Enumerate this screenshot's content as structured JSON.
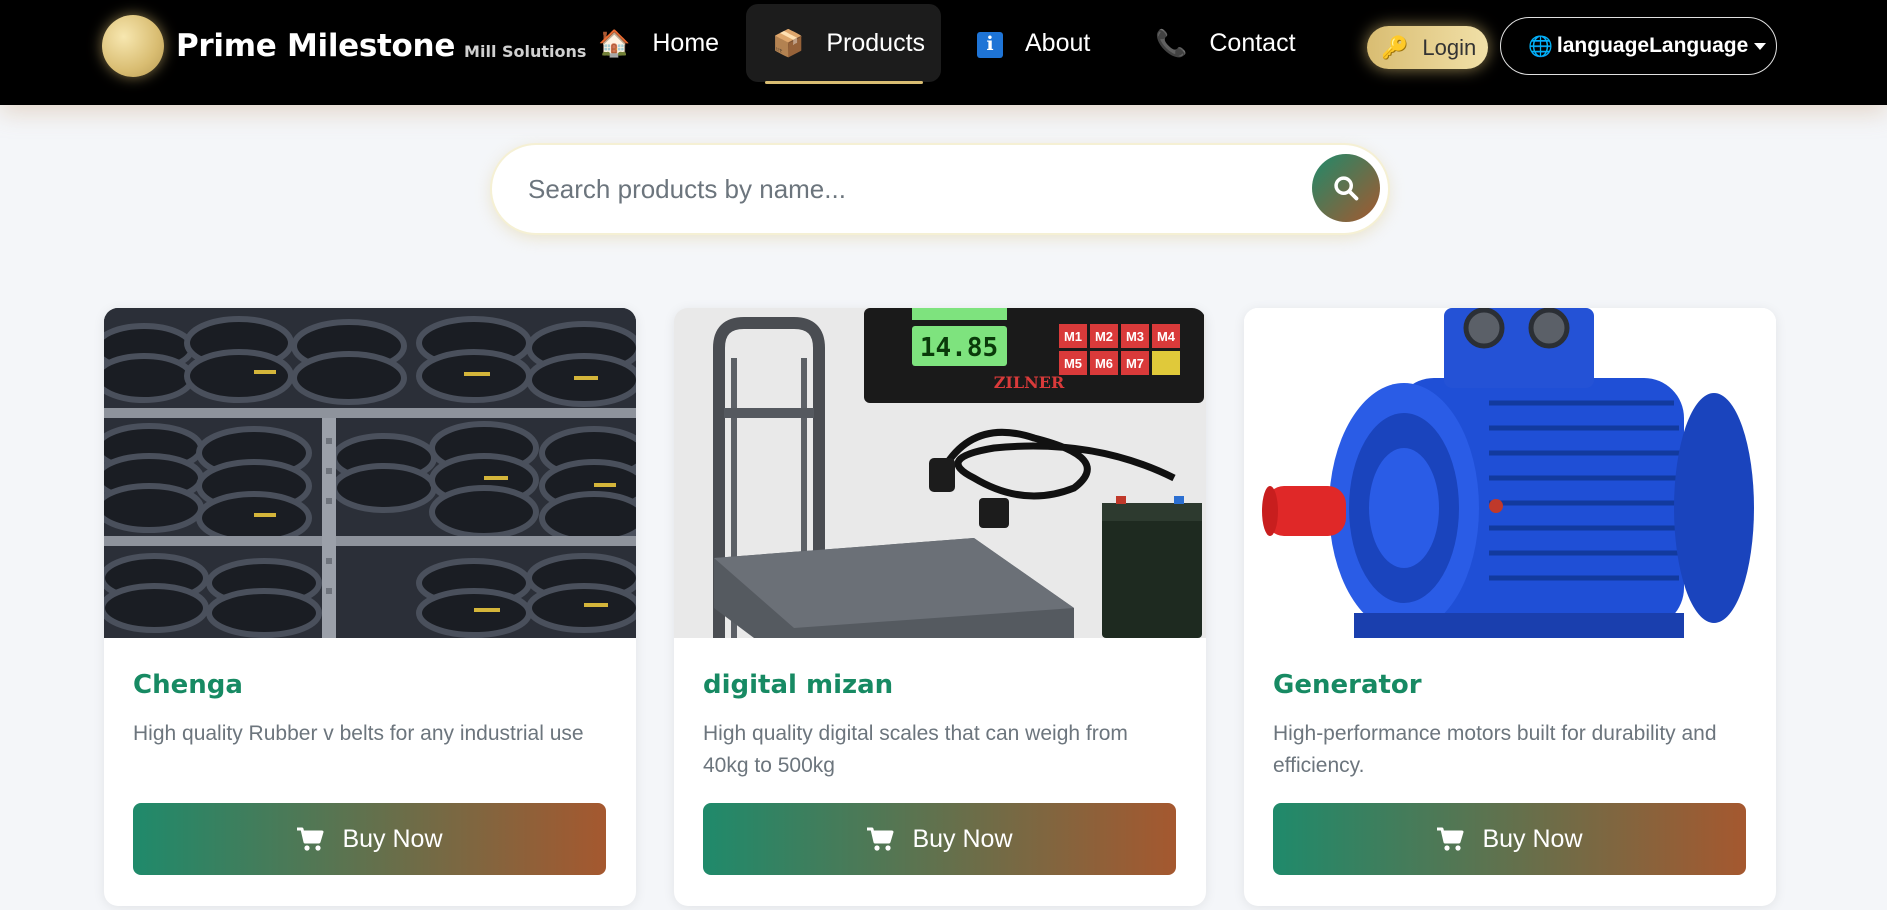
{
  "brand": {
    "name": "Prime Milestone",
    "subtitle": "Mill Solutions"
  },
  "nav": {
    "items": [
      {
        "label": "Home",
        "icon": "house-icon"
      },
      {
        "label": "Products",
        "icon": "package-icon",
        "active": true
      },
      {
        "label": "About",
        "icon": "info-icon"
      },
      {
        "label": "Contact",
        "icon": "phone-icon"
      }
    ],
    "login_label": "Login",
    "language_label": "languageLanguage"
  },
  "search": {
    "placeholder": "Search products by name..."
  },
  "products": [
    {
      "title": "Chenga",
      "description": "High quality Rubber v belts for any industrial use",
      "button": "Buy Now"
    },
    {
      "title": "digital mizan",
      "description": "High quality digital scales that can weigh from 40kg to 500kg",
      "button": "Buy Now"
    },
    {
      "title": "Generator",
      "description": "High-performance motors built for durability and efficiency.",
      "button": "Buy Now"
    }
  ],
  "scale_display": {
    "reading": "14.85",
    "keys": [
      "M1",
      "M2",
      "M3",
      "M4",
      "M5",
      "M6",
      "M7"
    ],
    "brand": "ZILNER"
  },
  "colors": {
    "accent_green": "#178a63",
    "accent_rust": "#a5582f",
    "gold": "#d9bd72",
    "nav_bg": "#000000"
  }
}
